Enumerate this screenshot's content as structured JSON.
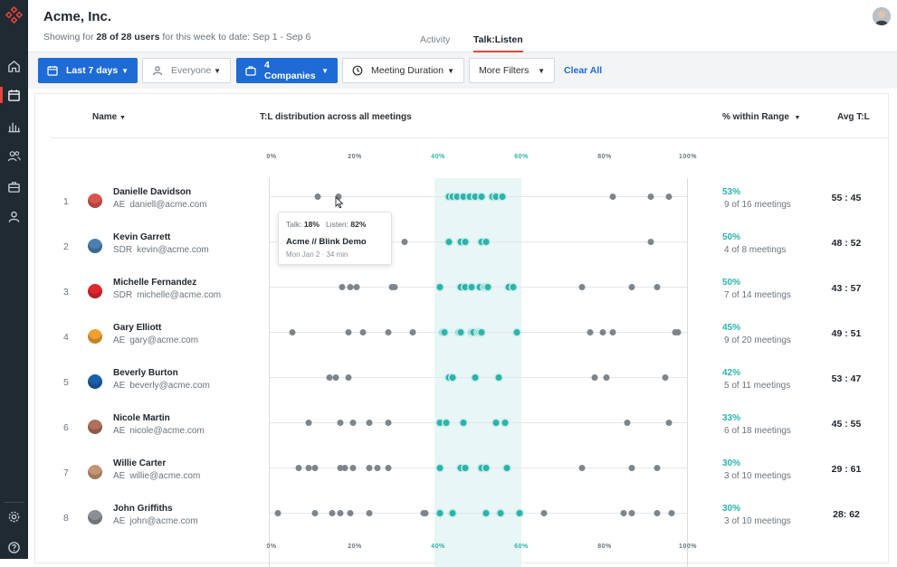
{
  "header": {
    "company": "Acme, Inc.",
    "subtitle_prefix": "Showing for ",
    "subtitle_count": "28 of 28 users",
    "subtitle_suffix": " for this week to date: Sep 1 - Sep 6",
    "tabs": [
      {
        "label": "Activity",
        "active": false
      },
      {
        "label": "Talk:Listen",
        "active": true
      }
    ]
  },
  "sidebar": {
    "icons": [
      "home-icon",
      "calendar-icon",
      "bar-chart-icon",
      "users-icon",
      "briefcase-icon",
      "user-icon",
      "settings-icon",
      "help-icon"
    ]
  },
  "filters": {
    "date": "Last 7 days",
    "people": "Everyone",
    "companies": "4 Companies",
    "duration": "Meeting Duration",
    "more": "More Filters",
    "clear": "Clear All"
  },
  "table": {
    "col_name": "Name",
    "col_dist": "T:L distribution across all meetings",
    "col_range": "% within Range",
    "col_avg": "Avg T:L",
    "ticks": [
      "0%",
      "20%",
      "40%",
      "60%",
      "80%",
      "100%"
    ],
    "range": [
      40,
      60
    ],
    "rows": [
      {
        "num": "1",
        "name": "Danielle Davidson",
        "role": "AE",
        "email": "daniell@acme.com",
        "pct": "53%",
        "meetings": "9 of 16 meetings",
        "avg": "55 : 45",
        "avatar_color": "#d9534f",
        "points": [
          11,
          16,
          42.5,
          43.5,
          44.5,
          46,
          47.5,
          49,
          50.5,
          53,
          54,
          55.5,
          82,
          91,
          95.5
        ]
      },
      {
        "num": "2",
        "name": "Kevin Garrett",
        "role": "SDR",
        "email": "kevin@acme.com",
        "pct": "50%",
        "meetings": "4 of 8 meetings",
        "avg": "48 : 52",
        "avatar_color": "#4a7fb0",
        "points": [
          32,
          42.5,
          45.5,
          46.5,
          50.5,
          51.5,
          91
        ]
      },
      {
        "num": "3",
        "name": "Michelle Fernandez",
        "role": "SDR",
        "email": "michelle@acme.com",
        "pct": "50%",
        "meetings": "7 of 14 meetings",
        "avg": "43 : 57",
        "avatar_color": "#e0262e",
        "points": [
          17,
          19,
          20.5,
          29,
          29.5,
          40.5,
          45.5,
          46.5,
          48,
          50,
          51,
          51.5,
          52,
          57,
          58,
          74.5,
          86.5,
          92.5
        ]
      },
      {
        "num": "4",
        "name": "Gary Elliott",
        "role": "AE",
        "email": "gary@acme.com",
        "pct": "45%",
        "meetings": "9 of 20 meetings",
        "avg": "49 : 51",
        "avatar_color": "#f0a030",
        "points": [
          5,
          18.5,
          22,
          28,
          34,
          41,
          41.5,
          45,
          45.5,
          48,
          48.5,
          49.5,
          50,
          50.5,
          59,
          76.5,
          79.5,
          82,
          97,
          97.5
        ]
      },
      {
        "num": "5",
        "name": "Beverly Burton",
        "role": "AE",
        "email": "beverly@acme.com",
        "pct": "42%",
        "meetings": "5 of 11 meetings",
        "avg": "53 : 47",
        "avatar_color": "#1a5fa8",
        "points": [
          14,
          15.5,
          18.5,
          42.5,
          43.5,
          49,
          54.5,
          77.5,
          80.5,
          94.5
        ]
      },
      {
        "num": "6",
        "name": "Nicole Martin",
        "role": "AE",
        "email": "nicole@acme.com",
        "pct": "33%",
        "meetings": "6 of 18 meetings",
        "avg": "45 : 55",
        "avatar_color": "#b0705a",
        "points": [
          9,
          16.5,
          19.5,
          23.5,
          28,
          40.5,
          42,
          46,
          54,
          56,
          85.5,
          95.5
        ]
      },
      {
        "num": "7",
        "name": "Willie Carter",
        "role": "AE",
        "email": "willie@acme.com",
        "pct": "30%",
        "meetings": "3 of 10 meetings",
        "avg": "29 : 61",
        "avatar_color": "#c49575",
        "points": [
          6.5,
          9,
          10.5,
          16.5,
          17.5,
          19.5,
          23.5,
          25.5,
          28,
          40.5,
          45.5,
          46.5,
          50.5,
          51.5,
          56.5,
          74.5,
          86.5,
          92.5
        ]
      },
      {
        "num": "8",
        "name": "John Griffiths",
        "role": "AE",
        "email": "john@acme.com",
        "pct": "30%",
        "meetings": "3 of 10 meetings",
        "avg": "28: 62",
        "avatar_color": "#8a8f95",
        "points": [
          1.5,
          10.5,
          14.5,
          16.5,
          19,
          23.5,
          36.5,
          37,
          40.5,
          43.5,
          51.5,
          55,
          59.5,
          65.5,
          84.5,
          86.5,
          92.5,
          96
        ]
      }
    ]
  },
  "tooltip": {
    "talk_label": "Talk:",
    "talk_value": "18%",
    "listen_label": "Listen:",
    "listen_value": "82%",
    "title": "Acme // Blink Demo",
    "meta": "Mon Jan 2  ·  34 min"
  },
  "colors": {
    "accent": "#e8443a",
    "primary": "#1e6bd6",
    "teal": "#2ab3ab",
    "sidebar": "#1f2a33"
  }
}
